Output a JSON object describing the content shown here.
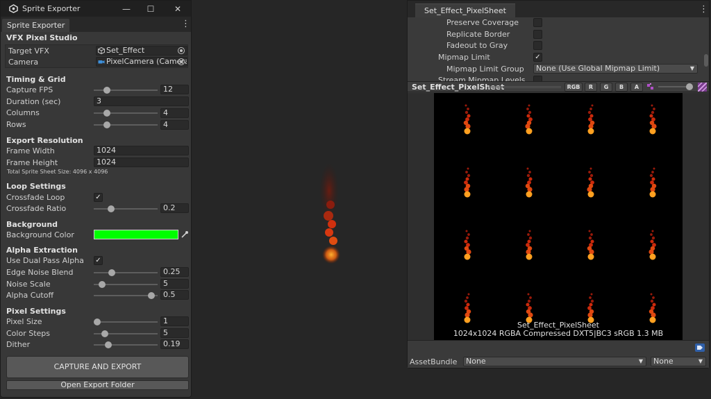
{
  "left_window": {
    "title": "Sprite Exporter",
    "tab": "Sprite Exporter",
    "header": "VFX Pixel Studio",
    "target_vfx": {
      "label": "Target VFX",
      "value": "Set_Effect"
    },
    "camera": {
      "label": "Camera",
      "value": "PixelCamera (Camera"
    },
    "timing": {
      "section": "Timing & Grid",
      "capture_fps": {
        "label": "Capture FPS",
        "value": "12",
        "fraction": 0.17
      },
      "duration": {
        "label": "Duration (sec)",
        "value": "3"
      },
      "columns": {
        "label": "Columns",
        "value": "4",
        "fraction": 0.17
      },
      "rows": {
        "label": "Rows",
        "value": "4",
        "fraction": 0.17
      }
    },
    "export": {
      "section": "Export Resolution",
      "frame_width": {
        "label": "Frame Width",
        "value": "1024"
      },
      "frame_height": {
        "label": "Frame Height",
        "value": "1024"
      },
      "total_size": "Total Sprite Sheet Size: 4096 x 4096"
    },
    "loop": {
      "section": "Loop Settings",
      "crossfade_loop": {
        "label": "Crossfade Loop",
        "checked": true
      },
      "crossfade_ratio": {
        "label": "Crossfade Ratio",
        "value": "0.2",
        "fraction": 0.24
      }
    },
    "background": {
      "section": "Background",
      "color": {
        "label": "Background Color",
        "value": "#00ff00"
      }
    },
    "alpha": {
      "section": "Alpha Extraction",
      "dual_pass": {
        "label": "Use Dual Pass Alpha",
        "checked": true
      },
      "edge_noise": {
        "label": "Edge Noise Blend",
        "value": "0.25",
        "fraction": 0.25
      },
      "noise_scale": {
        "label": "Noise Scale",
        "value": "5",
        "fraction": 0.08
      },
      "alpha_cutoff": {
        "label": "Alpha Cutoff",
        "value": "0.5",
        "fraction": 0.95
      }
    },
    "pixel": {
      "section": "Pixel Settings",
      "pixel_size": {
        "label": "Pixel Size",
        "value": "1",
        "fraction": 0.0
      },
      "color_steps": {
        "label": "Color Steps",
        "value": "5",
        "fraction": 0.13
      },
      "dither": {
        "label": "Dither",
        "value": "0.19",
        "fraction": 0.19
      }
    },
    "capture_button": "CAPTURE AND EXPORT",
    "open_folder_button": "Open Export Folder"
  },
  "right_window": {
    "tab": "Set_Effect_PixelSheet",
    "preserve_coverage": {
      "label": "Preserve Coverage",
      "checked": false
    },
    "replicate_border": {
      "label": "Replicate Border",
      "checked": false
    },
    "fadeout_to_gray": {
      "label": "Fadeout to Gray",
      "checked": false
    },
    "mipmap_limit": {
      "label": "Mipmap Limit",
      "checked": true
    },
    "mipmap_limit_group": {
      "label": "Mipmap Limit Group",
      "value": "None (Use Global Mipmap Limit)"
    },
    "stream_partial": "Stream Mipmap Levels",
    "preview": {
      "title": "Set_Effect_PixelSheet",
      "channels": [
        "RGB",
        "R",
        "G",
        "B",
        "A"
      ],
      "mip_fraction": 1.0,
      "info_name": "Set_Effect_PixelSheet",
      "info_details": "1024x1024  RGBA Compressed DXT5|BC3 sRGB   1.3 MB"
    },
    "assetbundle": {
      "label": "AssetBundle",
      "name": "None",
      "variant": "None"
    }
  }
}
